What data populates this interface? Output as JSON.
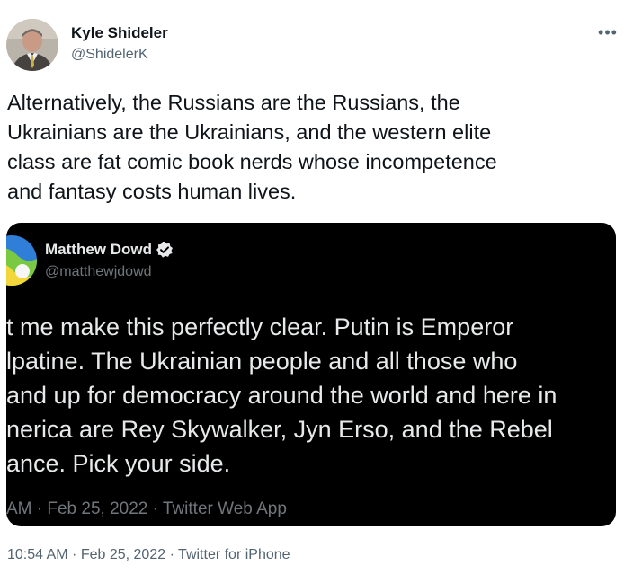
{
  "author": {
    "name": "Kyle Shideler",
    "handle": "@ShidelerK"
  },
  "more_icon": "more-horizontal-icon",
  "tweet": {
    "lines": [
      "Alternatively, the Russians are the Russians, the",
      "Ukrainians are the Ukrainians, and the western elite",
      "class are fat comic book nerds whose incompetence",
      "and fantasy costs human lives."
    ],
    "meta": "10:54 AM · Feb 25, 2022 · Twitter for iPhone"
  },
  "embedded": {
    "name": "Matthew Dowd",
    "verified_icon": "verified-badge-icon",
    "handle": "@matthewjdowd",
    "lines": [
      "t me make this perfectly clear.  Putin is Emperor",
      "lpatine.  The Ukrainian people and all those who",
      "and up for democracy around the world and here in",
      "nerica are Rey Skywalker, Jyn Erso, and the Rebel",
      "ance.  Pick your side."
    ],
    "meta": " AM · Feb 25, 2022 · Twitter Web App"
  },
  "colors": {
    "primary_text": "#0f1419",
    "secondary_text": "#536471",
    "embed_bg": "#000000",
    "embed_text": "#e7e9ea",
    "embed_secondary": "#71767b",
    "verified_blue": "#1d9bf0"
  }
}
